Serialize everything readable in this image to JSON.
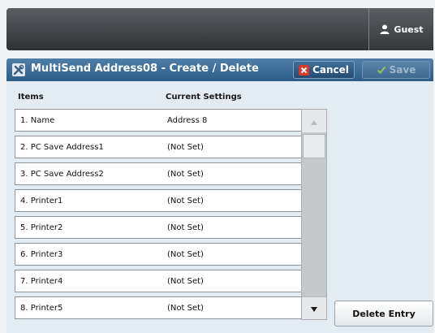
{
  "status_bar": {
    "user_label": "Guest"
  },
  "title_bar": {
    "title": "MultiSend Address08 - Create / Delete",
    "cancel_label": "Cancel",
    "save_label": "Save"
  },
  "table": {
    "headers": {
      "items": "Items",
      "current_settings": "Current Settings"
    },
    "rows": [
      {
        "item": "1. Name",
        "value": "Address 8"
      },
      {
        "item": "2. PC Save Address1",
        "value": "(Not Set)"
      },
      {
        "item": "3. PC Save Address2",
        "value": "(Not Set)"
      },
      {
        "item": "4. Printer1",
        "value": "(Not Set)"
      },
      {
        "item": "5. Printer2",
        "value": "(Not Set)"
      },
      {
        "item": "6. Printer3",
        "value": "(Not Set)"
      },
      {
        "item": "7. Printer4",
        "value": "(Not Set)"
      },
      {
        "item": "8. Printer5",
        "value": "(Not Set)"
      }
    ]
  },
  "actions": {
    "delete_entry_label": "Delete Entry"
  },
  "icons": {
    "user": "user-icon",
    "tools": "tools-icon",
    "cancel": "cancel-x-icon",
    "save": "checkmark-icon",
    "scroll_up": "triangle-up-icon",
    "scroll_down": "triangle-down-icon"
  },
  "colors": {
    "title_bar": "#2c5d86",
    "panel_bg": "#e2ecf2",
    "cancel_x": "#d83a2a",
    "save_check_disabled": "#8fbf5f"
  }
}
